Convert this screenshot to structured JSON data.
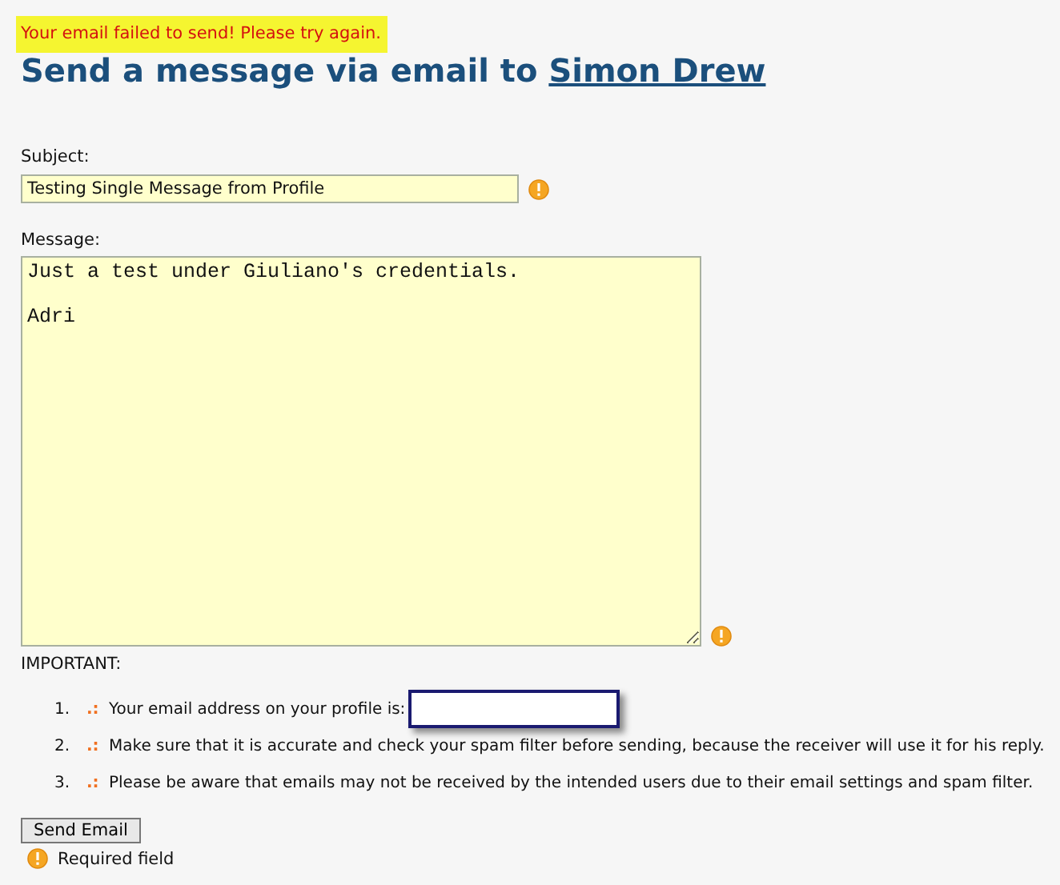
{
  "error_banner": "Your email failed to send! Please try again.",
  "heading": {
    "text": "Send a message via email to",
    "link": "Simon Drew"
  },
  "subject": {
    "label": "Subject:",
    "value": "Testing Single Message from Profile",
    "required": true
  },
  "message": {
    "label": "Message:",
    "value": "Just a test under Giuliano's credentials.\n\nAdri",
    "required": true
  },
  "important": {
    "label": "IMPORTANT:",
    "items": [
      {
        "number": "1.",
        "marker": ".:",
        "text": "Your email address on your profile is:",
        "redacted": true
      },
      {
        "number": "2.",
        "marker": ".:",
        "text": "Make sure that it is accurate and check your spam filter before sending, because the receiver will use it for his reply.",
        "redacted": false
      },
      {
        "number": "3.",
        "marker": ".:",
        "text": "Please be aware that emails may not be received by the intended users due to their email settings and spam filter.",
        "redacted": false
      }
    ]
  },
  "button": "Send Email",
  "legend": "Required field"
}
